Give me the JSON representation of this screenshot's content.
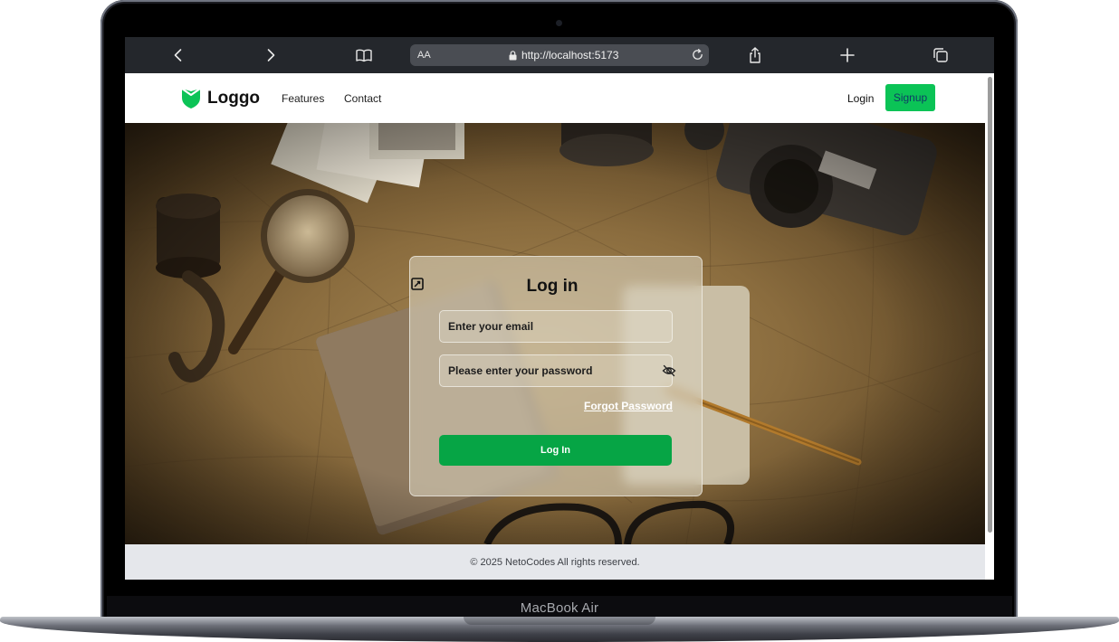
{
  "device": {
    "label": "MacBook Air"
  },
  "browser": {
    "text_size_label": "AA",
    "url": "http://localhost:5173",
    "icons": [
      "back-icon",
      "forward-icon",
      "reader-icon",
      "lock-icon",
      "reload-icon",
      "share-icon",
      "new-tab-icon",
      "tabs-icon"
    ]
  },
  "navbar": {
    "logo_text": "Loggo",
    "links": [
      {
        "label": "Features"
      },
      {
        "label": "Contact"
      }
    ],
    "login_label": "Login",
    "signup_label": "Signup"
  },
  "login_card": {
    "title": "Log in",
    "email_placeholder": "Enter your email",
    "password_placeholder": "Please enter your password",
    "forgot_label": "Forgot Password",
    "submit_label": "Log In"
  },
  "footer": {
    "text": "© 2025 NetoCodes All rights reserved."
  },
  "colors": {
    "brand_green": "#0bc356",
    "button_green": "#06a545",
    "browser_chrome": "#24272c",
    "footer_bg": "#e5e7eb"
  }
}
